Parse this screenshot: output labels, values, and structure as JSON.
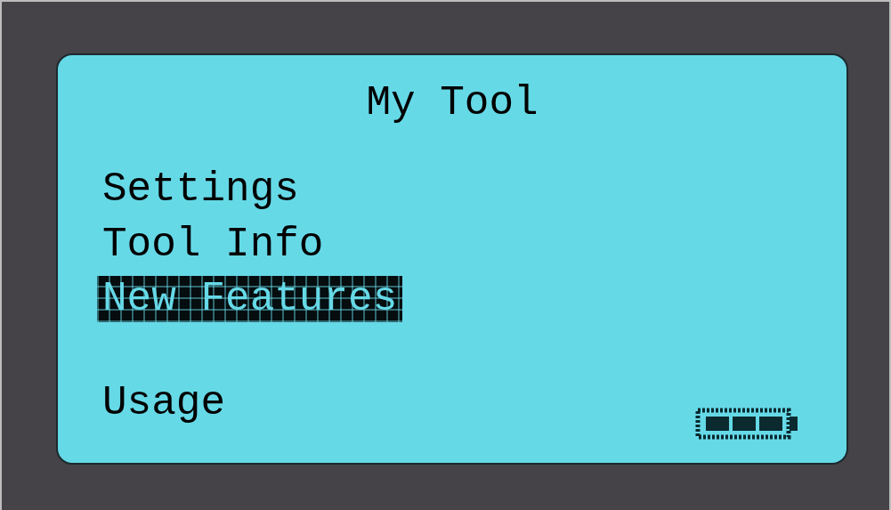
{
  "screen": {
    "title": "My Tool",
    "menu": [
      {
        "label": "Settings",
        "selected": false
      },
      {
        "label": "Tool Info",
        "selected": false
      },
      {
        "label": "New Features",
        "selected": true
      }
    ],
    "lower_menu": [
      {
        "label": "Usage",
        "selected": false
      }
    ]
  }
}
